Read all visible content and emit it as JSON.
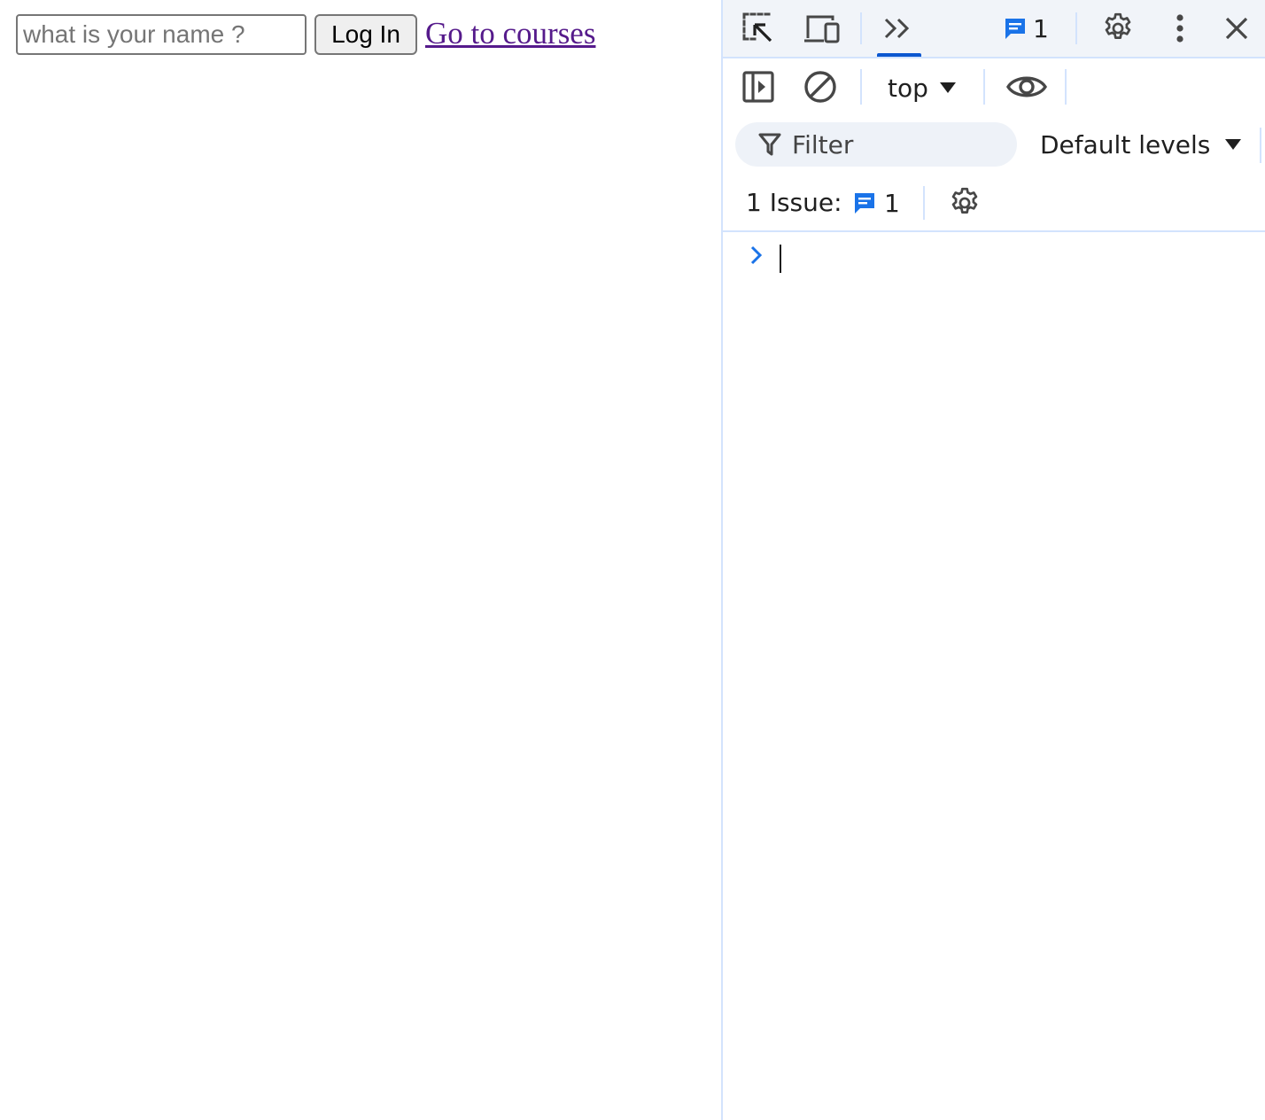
{
  "page": {
    "name_input": {
      "value": "",
      "placeholder": "what is your name ?"
    },
    "login_button": "Log In",
    "courses_link": "Go to courses"
  },
  "devtools": {
    "topbar": {
      "icons": [
        "inspect-element-icon",
        "device-toggle-icon",
        "more-tabs-icon",
        "issues-icon",
        "settings-icon",
        "more-options-icon",
        "close-icon"
      ],
      "issues_count": "1"
    },
    "console_toolbar": {
      "icons": [
        "sidebar-toggle-icon",
        "clear-console-icon",
        "live-expression-eye-icon"
      ],
      "context": "top"
    },
    "filter": {
      "placeholder": "Filter",
      "levels": "Default levels"
    },
    "issues_row": {
      "label": "1 Issue:",
      "count": "1"
    }
  },
  "colors": {
    "accent": "#0b57d0",
    "issue_icon": "#1a73e8",
    "visited_link": "#551a8b",
    "divider": "#d3e3fd"
  }
}
